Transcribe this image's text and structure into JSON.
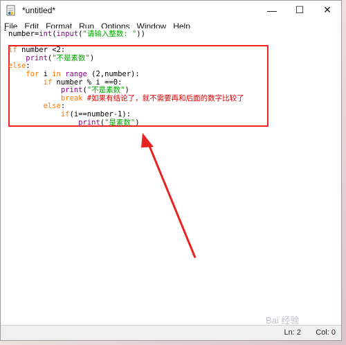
{
  "window": {
    "title": "*untitled*",
    "controls": {
      "minimize": "—",
      "maximize": "☐",
      "close": "✕"
    }
  },
  "menu": [
    {
      "label": "File",
      "mnemonic_index": 0
    },
    {
      "label": "Edit",
      "mnemonic_index": 0
    },
    {
      "label": "Format",
      "mnemonic_index": 1
    },
    {
      "label": "Run",
      "mnemonic_index": 0
    },
    {
      "label": "Options",
      "mnemonic_index": 0
    },
    {
      "label": "Window",
      "mnemonic_index": 0
    },
    {
      "label": "Help",
      "mnemonic_index": 0
    }
  ],
  "code": [
    [
      {
        "t": "number=",
        "c": "plain"
      },
      {
        "t": "int",
        "c": "bi"
      },
      {
        "t": "(",
        "c": "plain"
      },
      {
        "t": "input",
        "c": "bi"
      },
      {
        "t": "(",
        "c": "plain"
      },
      {
        "t": "\"请输入整数: \"",
        "c": "str"
      },
      {
        "t": "))",
        "c": "plain"
      }
    ],
    [],
    [
      {
        "t": "if",
        "c": "kw"
      },
      {
        "t": " number <2:",
        "c": "plain"
      }
    ],
    [
      {
        "t": "    ",
        "c": "plain"
      },
      {
        "t": "print",
        "c": "bi"
      },
      {
        "t": "(",
        "c": "plain"
      },
      {
        "t": "\"不是素数\"",
        "c": "str"
      },
      {
        "t": ")",
        "c": "plain"
      }
    ],
    [
      {
        "t": "else",
        "c": "kw"
      },
      {
        "t": ":",
        "c": "plain"
      }
    ],
    [
      {
        "t": "    ",
        "c": "plain"
      },
      {
        "t": "for",
        "c": "kw"
      },
      {
        "t": " i ",
        "c": "plain"
      },
      {
        "t": "in",
        "c": "kw"
      },
      {
        "t": " ",
        "c": "plain"
      },
      {
        "t": "range",
        "c": "bi"
      },
      {
        "t": " (2,number):",
        "c": "plain"
      }
    ],
    [
      {
        "t": "        ",
        "c": "plain"
      },
      {
        "t": "if",
        "c": "kw"
      },
      {
        "t": " number % i ==0:",
        "c": "plain"
      }
    ],
    [
      {
        "t": "            ",
        "c": "plain"
      },
      {
        "t": "print",
        "c": "bi"
      },
      {
        "t": "(",
        "c": "plain"
      },
      {
        "t": "\"不是素数\"",
        "c": "str"
      },
      {
        "t": ")",
        "c": "plain"
      }
    ],
    [
      {
        "t": "            ",
        "c": "plain"
      },
      {
        "t": "break",
        "c": "kw"
      },
      {
        "t": " #如果有结论了，就不需要再和后面的数字比较了",
        "c": "cm"
      }
    ],
    [
      {
        "t": "        ",
        "c": "plain"
      },
      {
        "t": "else",
        "c": "kw"
      },
      {
        "t": ":",
        "c": "plain"
      }
    ],
    [
      {
        "t": "            ",
        "c": "plain"
      },
      {
        "t": "if",
        "c": "kw"
      },
      {
        "t": "(i==number-1):",
        "c": "plain"
      }
    ],
    [
      {
        "t": "                ",
        "c": "plain"
      },
      {
        "t": "print",
        "c": "bi"
      },
      {
        "t": "(",
        "c": "plain"
      },
      {
        "t": "\"是素数\"",
        "c": "str"
      },
      {
        "t": ")",
        "c": "plain"
      }
    ]
  ],
  "status": {
    "line": "Ln: 2",
    "col": "Col: 0"
  },
  "watermark": "Bai 经验",
  "colors": {
    "keyword": "#ff7700",
    "builtin": "#900090",
    "string": "#00aa00",
    "comment": "#dd0000",
    "annotation": "#e8231f"
  },
  "icons": {
    "app": "idle-file-icon"
  }
}
